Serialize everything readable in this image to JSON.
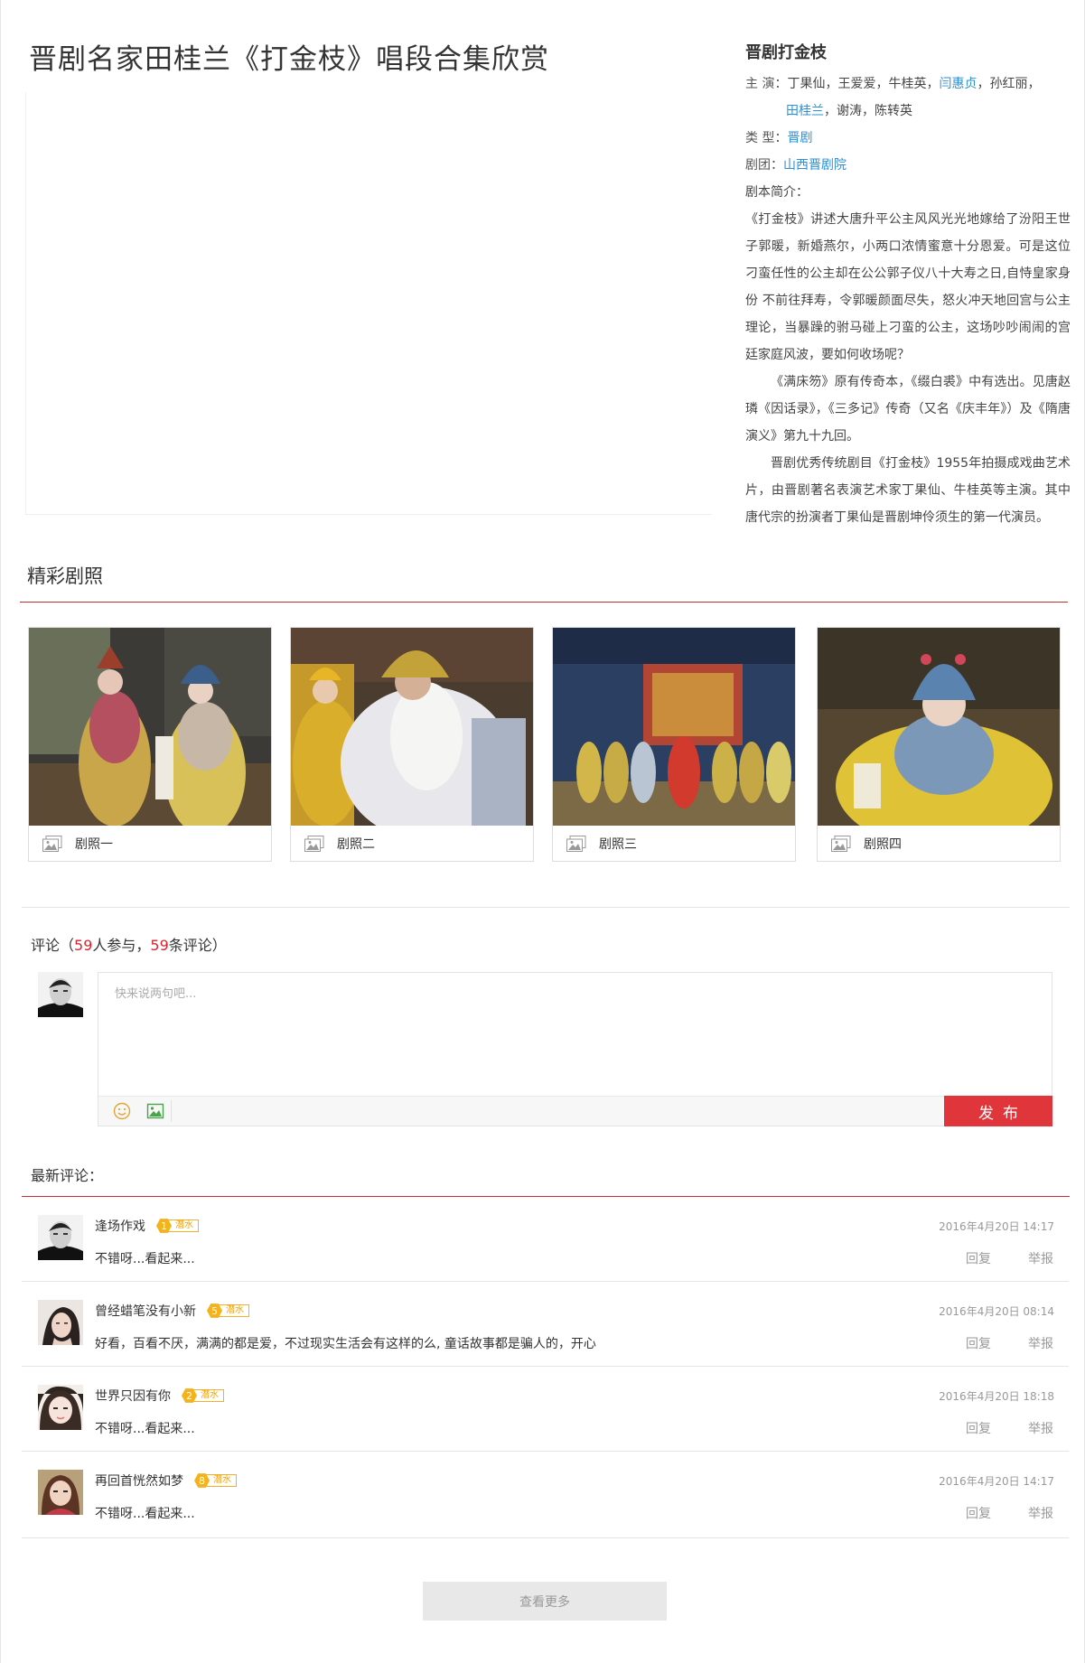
{
  "page": {
    "title": "晋剧名家田桂兰《打金枝》唱段合集欣赏"
  },
  "info": {
    "title": "晋剧打金枝",
    "cast_label": "主 演：",
    "cast_plain1": "丁果仙，王爱爱，牛桂英，",
    "cast_link1": "闫惠贞",
    "cast_plain2": "，孙红丽，",
    "cast_link2": "田桂兰",
    "cast_plain3": "，谢涛，陈转英",
    "type_label": "类 型：",
    "type_value": "晋剧",
    "troupe_label": "剧团：",
    "troupe_value": "山西晋剧院",
    "synopsis_label": "剧本简介：",
    "synopsis_p1": "《打金枝》讲述大唐升平公主风风光光地嫁给了汾阳王世子郭暖，新婚燕尔，小两口浓情蜜意十分恩爱。可是这位刁蛮任性的公主却在公公郭子仪八十大寿之日,自恃皇家身份 不前往拜寿，令郭暖颜面尽失，怒火冲天地回宫与公主理论，当暴躁的驸马碰上刁蛮的公主，这场吵吵闹闹的宫廷家庭风波，要如何收场呢？",
    "synopsis_p2": "《满床笏》原有传奇本，《缀白裘》中有选出。见唐赵璘《因话录》，《三多记》传奇（又名《庆丰年》）及《隋唐演义》第九十九回。",
    "synopsis_p3": "晋剧优秀传统剧目《打金枝》1955年拍摄成戏曲艺术片，由晋剧著名表演艺术家丁果仙、牛桂英等主演。其中唐代宗的扮演者丁果仙是晋剧坤伶须生的第一代演员。"
  },
  "photos": {
    "section_title": "精彩剧照",
    "items": [
      {
        "caption": "剧照一"
      },
      {
        "caption": "剧照二"
      },
      {
        "caption": "剧照三"
      },
      {
        "caption": "剧照四"
      }
    ]
  },
  "comments": {
    "head_prefix": "评论（",
    "participants": "59",
    "participants_suffix": "人参与，",
    "count": "59",
    "count_suffix": "条评论）",
    "placeholder": "快来说两句吧...",
    "publish_label": "发布",
    "latest_label": "最新评论：",
    "items": [
      {
        "user": "逢场作戏",
        "level": "1",
        "level_tag": "潜水",
        "time": "2016年4月20日 14:17",
        "text": "不错呀...看起来...",
        "reply": "回复",
        "report": "举报"
      },
      {
        "user": "曾经蜡笔没有小新",
        "level": "5",
        "level_tag": "潜水",
        "time": "2016年4月20日 08:14",
        "text": "好看，百看不厌，满满的都是爱，不过现实生活会有这样的么, 童话故事都是骗人的，开心",
        "reply": "回复",
        "report": "举报"
      },
      {
        "user": "世界只因有你",
        "level": "2",
        "level_tag": "潜水",
        "time": "2016年4月20日 18:18",
        "text": "不错呀...看起来...",
        "reply": "回复",
        "report": "举报"
      },
      {
        "user": "再回首恍然如梦",
        "level": "8",
        "level_tag": "潜水",
        "time": "2016年4月20日 14:17",
        "text": "不错呀...看起来...",
        "reply": "回复",
        "report": "举报"
      }
    ],
    "more_label": "查看更多"
  },
  "colors": {
    "accent_red": "#c0302e",
    "publish_red": "#e0363b",
    "link_blue": "#2d8fd6",
    "level_orange": "#f5b21b"
  }
}
